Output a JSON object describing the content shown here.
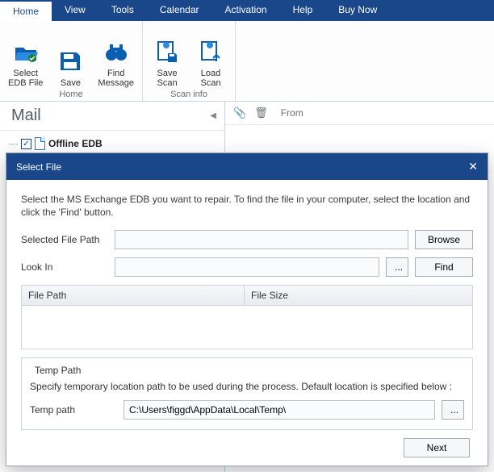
{
  "tabs": [
    "Home",
    "View",
    "Tools",
    "Calendar",
    "Activation",
    "Help",
    "Buy Now"
  ],
  "ribbon": {
    "home": {
      "title": "Home",
      "buttons": [
        {
          "label": "Select\nEDB File",
          "icon": "folder-open"
        },
        {
          "label": "Save",
          "icon": "save"
        },
        {
          "label": "Find\nMessage",
          "icon": "binoculars"
        }
      ]
    },
    "scaninfo": {
      "title": "Scan info",
      "buttons": [
        {
          "label": "Save\nScan",
          "icon": "doc-save"
        },
        {
          "label": "Load\nScan",
          "icon": "doc-load"
        }
      ]
    }
  },
  "sidebar": {
    "title": "Mail",
    "node": "Offline EDB"
  },
  "messages": {
    "from_label": "From"
  },
  "dialog": {
    "title": "Select File",
    "instruction": "Select the MS Exchange EDB you want to repair. To find the file in your computer, select the location and click the 'Find' button.",
    "selected_label": "Selected File Path",
    "selected_value": "",
    "browse": "Browse",
    "lookin_label": "Look In",
    "lookin_value": "",
    "dots": "...",
    "find": "Find",
    "cols": {
      "filepath": "File Path",
      "filesize": "File Size"
    },
    "temp": {
      "legend": "Temp Path",
      "desc": "Specify temporary location path to be used during the process. Default location is specified below :",
      "label": "Temp path",
      "value": "C:\\Users\\figgd\\AppData\\Local\\Temp\\"
    },
    "next": "Next"
  }
}
